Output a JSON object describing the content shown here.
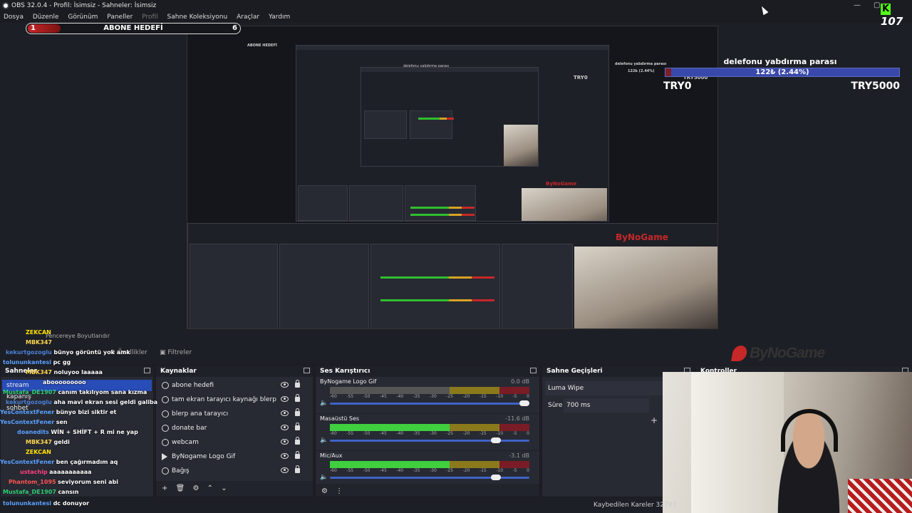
{
  "window": {
    "title": "OBS 32.0.4 - Profil: İsimsiz - Sahneler: İsimsiz",
    "minimize": "—",
    "maximize": "▢"
  },
  "menu": {
    "items": [
      "Dosya",
      "Düzenle",
      "Görünüm",
      "Paneller",
      "Profil",
      "Sahne Koleksiyonu",
      "Araçlar",
      "Yardım"
    ]
  },
  "overlay": {
    "sub_goal": {
      "current": "1",
      "title": "ABONE HEDEFİ",
      "target": "6"
    },
    "kick_count": "107",
    "donation": {
      "title": "delefonu yabdırma parası",
      "progress_text": "122₺ (2.44%)",
      "progress_fraction": 0.0244,
      "min": "TRY0",
      "max": "TRY5000"
    },
    "brand": "ByNoGame"
  },
  "preview": {
    "nested_texts": [
      "ABONE HEDEFİ",
      "delefonu yabdırma parası",
      "122₺ (2.44%)",
      "TRY0",
      "TRY5000",
      "ByNoGame"
    ]
  },
  "resize_label": "Pencereye Boyutlandır",
  "toolbar": {
    "properties": "Özellikler",
    "filters": "Filtreler"
  },
  "docks": {
    "scenes": {
      "title": "Sahneler",
      "items": [
        "stream",
        "kapanış",
        "sohbet"
      ],
      "active_index": 0
    },
    "sources": {
      "title": "Kaynaklar",
      "items": [
        "abone hedefi",
        "tam ekran tarayıcı kaynağı blerp",
        "blerp ana tarayıcı",
        "donate bar",
        "webcam",
        "ByNogame Logo Gif",
        "Bağış"
      ]
    },
    "mixer": {
      "title": "Ses Karıştırıcı",
      "scale": [
        "-60",
        "-55",
        "-50",
        "-45",
        "-40",
        "-35",
        "-30",
        "-25",
        "-20",
        "-15",
        "-10",
        "-5",
        "0"
      ],
      "channels": [
        {
          "name": "ByNogame Logo Gif",
          "db": "0.0 dB",
          "level": 0.0
        },
        {
          "name": "Masaüstü Ses",
          "db": "-11.6 dB",
          "level": 0.7
        },
        {
          "name": "Mic/Aux",
          "db": "-3.1 dB",
          "level": 0.95
        }
      ]
    },
    "transitions": {
      "title": "Sahne Geçişleri",
      "transition": "Luma Wipe",
      "duration_label": "Süre",
      "duration": "700 ms"
    },
    "controls": {
      "title": "Kontroller"
    }
  },
  "status": {
    "dropped_frames": "Kaybedilen Kareler 32793"
  },
  "chat": [
    {
      "user": "ZEKCAN",
      "msg": "",
      "color": "#ffe000"
    },
    {
      "user": "MBK347",
      "msg": "",
      "color": "#ffd54f"
    },
    {
      "user": "kekurtgozoglu",
      "msg": "bünyo görüntü yok amk",
      "color": "#4a7fd4"
    },
    {
      "user": "tolununkantesi",
      "msg": "pc gg",
      "color": "#5aa0ff"
    },
    {
      "user": "MBK347",
      "msg": "noluyoo laaaaa",
      "color": "#ffd54f"
    },
    {
      "user": "",
      "msg": "abooooooooo",
      "color": "#5aa0ff"
    },
    {
      "user": "Mustafa_DE1907",
      "msg": "canım takılıyom sana kızma",
      "color": "#2ecc71"
    },
    {
      "user": "kekurtgozoglu",
      "msg": "aha mavi ekran sesi geldi galiba",
      "color": "#4a7fd4"
    },
    {
      "user": "YesContextFener",
      "msg": "bünyo bizi siktir et",
      "color": "#5aa0ff"
    },
    {
      "user": "YesContextFener",
      "msg": "sen",
      "color": "#5aa0ff"
    },
    {
      "user": "doanedits",
      "msg": "WİN + SHİFT + R mi ne yap",
      "color": "#5aa0ff"
    },
    {
      "user": "MBK347",
      "msg": "geldi",
      "color": "#ffd54f"
    },
    {
      "user": "ZEKCAN",
      "msg": "",
      "color": "#ffe000"
    },
    {
      "user": "YesContextFener",
      "msg": "ben çağırmadım aq",
      "color": "#5aa0ff"
    },
    {
      "user": "ustachip",
      "msg": "aaaaaaaaaaa",
      "color": "#ff4081"
    },
    {
      "user": "Phantom_1095",
      "msg": "seviyorum seni abi",
      "color": "#ff5252"
    },
    {
      "user": "Mustafa_DE1907",
      "msg": "cansın",
      "color": "#2ecc71"
    },
    {
      "user": "tolununkantesi",
      "msg": "dc donuyor",
      "color": "#5aa0ff"
    }
  ],
  "colors": {
    "accent": "#284cb8",
    "bg": "#1d1f26",
    "panel": "#272a33",
    "kick": "#53fc18",
    "brand_red": "#c62828"
  }
}
